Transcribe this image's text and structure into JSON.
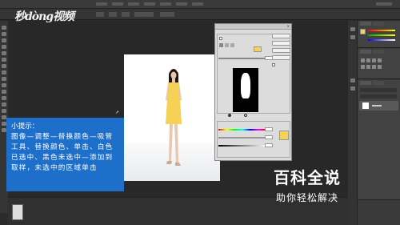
{
  "logo": {
    "text": "秒dòng视频"
  },
  "tip": {
    "title": "小提示：",
    "body": "图像—调整—替换颜色—吸管工具、替换颜色、单击、白色已选中、黑色未选中—添加到取样，未选中的区域单击"
  },
  "watermark": {
    "title": "百科全说",
    "subtitle": "助你轻松解决"
  },
  "colors": {
    "tip_bg": "#1e6fc9",
    "dress_yellow": "#f5d155",
    "workspace_bg": "#2b2b2b",
    "dialog_bg": "#dcdcdc"
  },
  "dialog": {
    "close_label": "✕"
  }
}
